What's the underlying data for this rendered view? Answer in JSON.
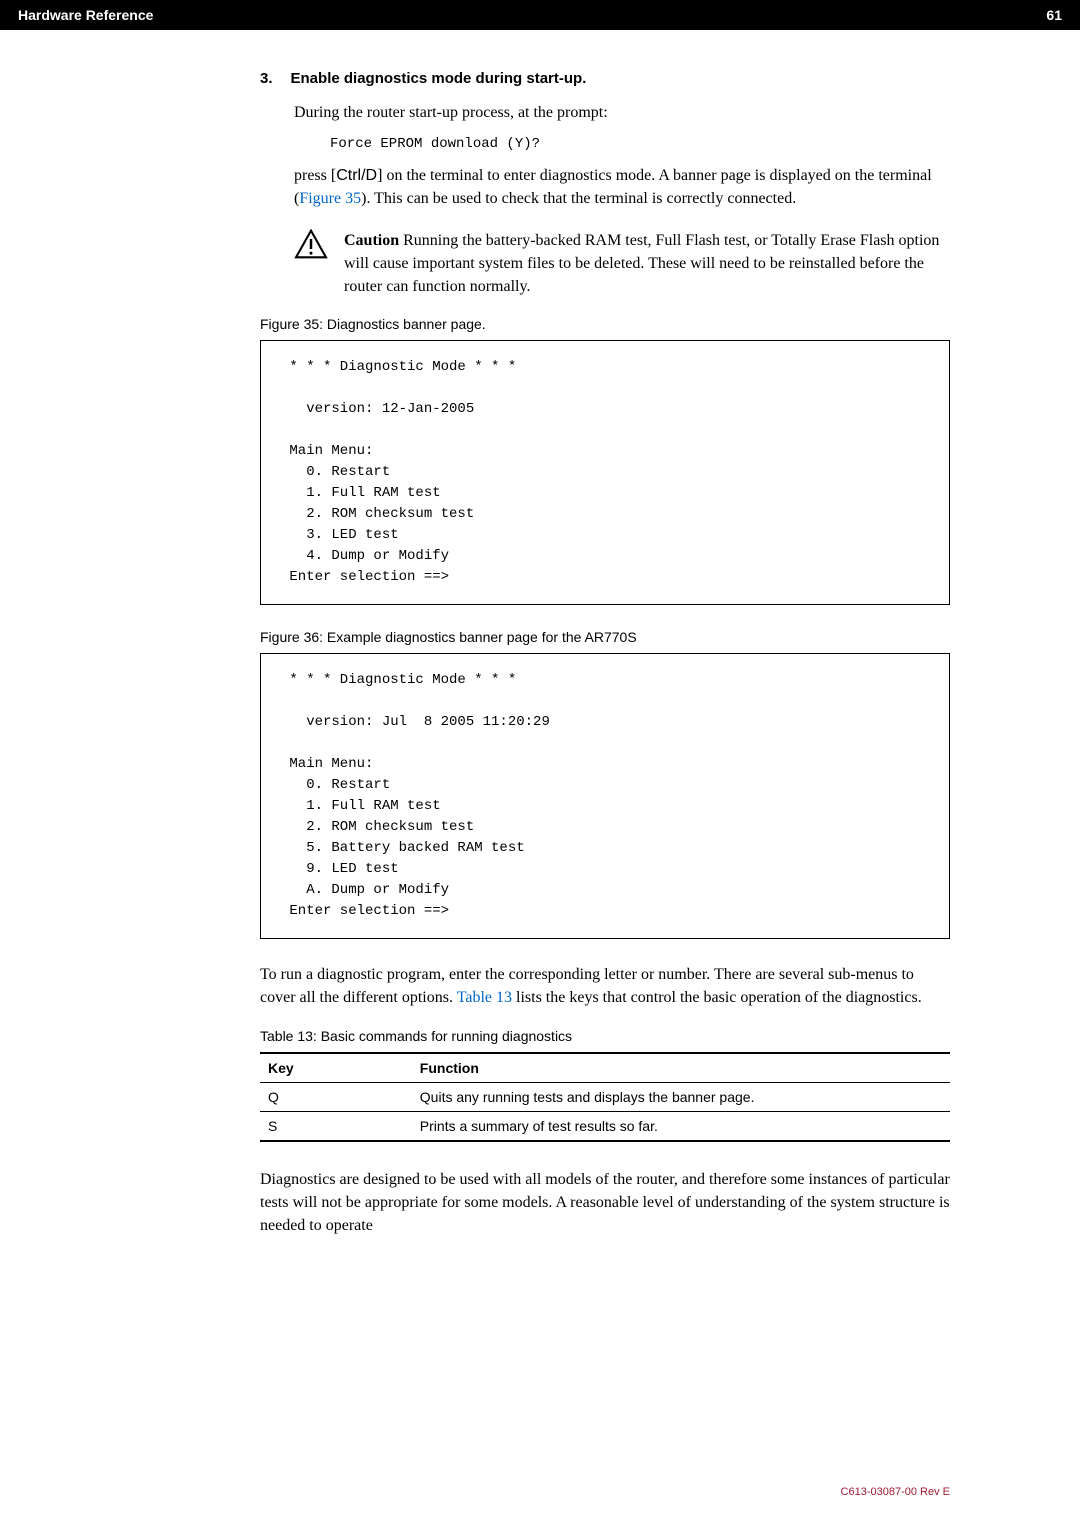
{
  "header": {
    "section_title": "Hardware Reference",
    "page_number": "61"
  },
  "step": {
    "number": "3.",
    "title": "Enable diagnostics mode during start-up."
  },
  "para1": "During the router start-up process, at the prompt:",
  "code_prompt": "Force EPROM download (Y)?",
  "para2_a": "press [",
  "para2_key": "Ctrl/D",
  "para2_b": "] on the terminal to enter diagnostics mode. A banner page is displayed on the terminal (",
  "para2_link": "Figure 35",
  "para2_c": "). This can be used to check that the terminal is correctly connected.",
  "caution": {
    "label": "Caution",
    "text": "  Running the battery-backed RAM test, Full Flash test, or Totally Erase Flash option will cause important system files to be deleted. These will need to be reinstalled before the router can function normally."
  },
  "fig35_caption": "Figure 35: Diagnostics banner page.",
  "fig35_code": " * * * Diagnostic Mode * * *\n\n   version: 12-Jan-2005\n\n Main Menu:\n   0. Restart\n   1. Full RAM test\n   2. ROM checksum test\n   3. LED test\n   4. Dump or Modify\n Enter selection ==>",
  "fig36_caption": "Figure 36: Example diagnostics banner page for the AR770S",
  "fig36_code": " * * * Diagnostic Mode * * *\n\n   version: Jul  8 2005 11:20:29\n\n Main Menu:\n   0. Restart\n   1. Full RAM test\n   2. ROM checksum test\n   5. Battery backed RAM test\n   9. LED test\n   A. Dump or Modify\n Enter selection ==>",
  "para3_a": "To run a diagnostic program, enter the corresponding letter or number. There are several sub-menus to cover all the different options. ",
  "para3_link": "Table 13",
  "para3_b": " lists the keys that control the basic operation of the diagnostics.",
  "table_caption": "Table 13: Basic commands for running diagnostics",
  "table": {
    "headers": [
      "Key",
      "Function"
    ],
    "rows": [
      [
        "Q",
        "Quits any running tests and displays the banner page."
      ],
      [
        "S",
        "Prints a summary of test results so far."
      ]
    ]
  },
  "para4": "Diagnostics are designed to be used with all models of the router, and therefore some instances of particular tests will not be appropriate for some models. A reasonable level of understanding of the system structure is needed to operate",
  "footer": "C613-03087-00 Rev E"
}
